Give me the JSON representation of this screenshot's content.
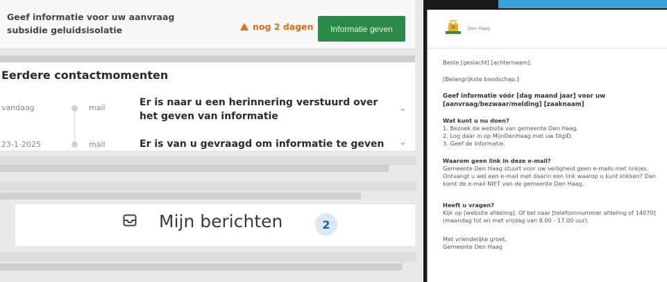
{
  "task": {
    "title": "Geef informatie voor uw aanvraag subsidie geluidsisolatie",
    "deadline": "nog 2 dagen",
    "button_label": "Informatie geven"
  },
  "contact": {
    "title": "Eerdere contactmomenten",
    "items": [
      {
        "date": "vandaag",
        "type": "mail",
        "text": "Er is naar u een herinnering verstuurd over het geven van informatie"
      },
      {
        "date": "23-1-2025",
        "type": "mail",
        "text": "Er is van u gevraagd om informatie te geven"
      }
    ]
  },
  "messages": {
    "label": "Mijn berichten",
    "count": "2"
  },
  "email": {
    "org": "Den Haag",
    "greeting": "Beste [geslacht] [achternaam],",
    "placeholder": "[Belangrijkste boodschap.]",
    "subject": "Geef informatie vóór [dag maand jaar] voor uw [aanvraag/bezwaar/melding] [zaaknaam]",
    "what_title": "Wat kunt u nu doen?",
    "steps": [
      "1. Bezoek de website van gemeente Den Haag.",
      "2. Log daar in op MijnDenHaag met uw DigiD.",
      "3. Geef de informatie."
    ],
    "nolink_title": "Waarom geen link in deze e-mail?",
    "nolink_text": "Gemeente Den Haag stuurt voor uw veiligheid geen e-mails met linkjes. Ontvangt u wel een e-mail met daarin een link waarop u kunt klikken? Dan komt de e-mail NIET van de gemeente Den Haag.",
    "questions_title": "Heeft u vragen?",
    "questions_text": "Kijk op [website afdeling]. Of bel naar [telefoonnummer afdeling of 14070] (maandag tot en met vrijdag van 8.00 - 17.00 uur).",
    "closing": "Met vriendelijke groet,",
    "sender": "Gemeente Den Haag"
  }
}
